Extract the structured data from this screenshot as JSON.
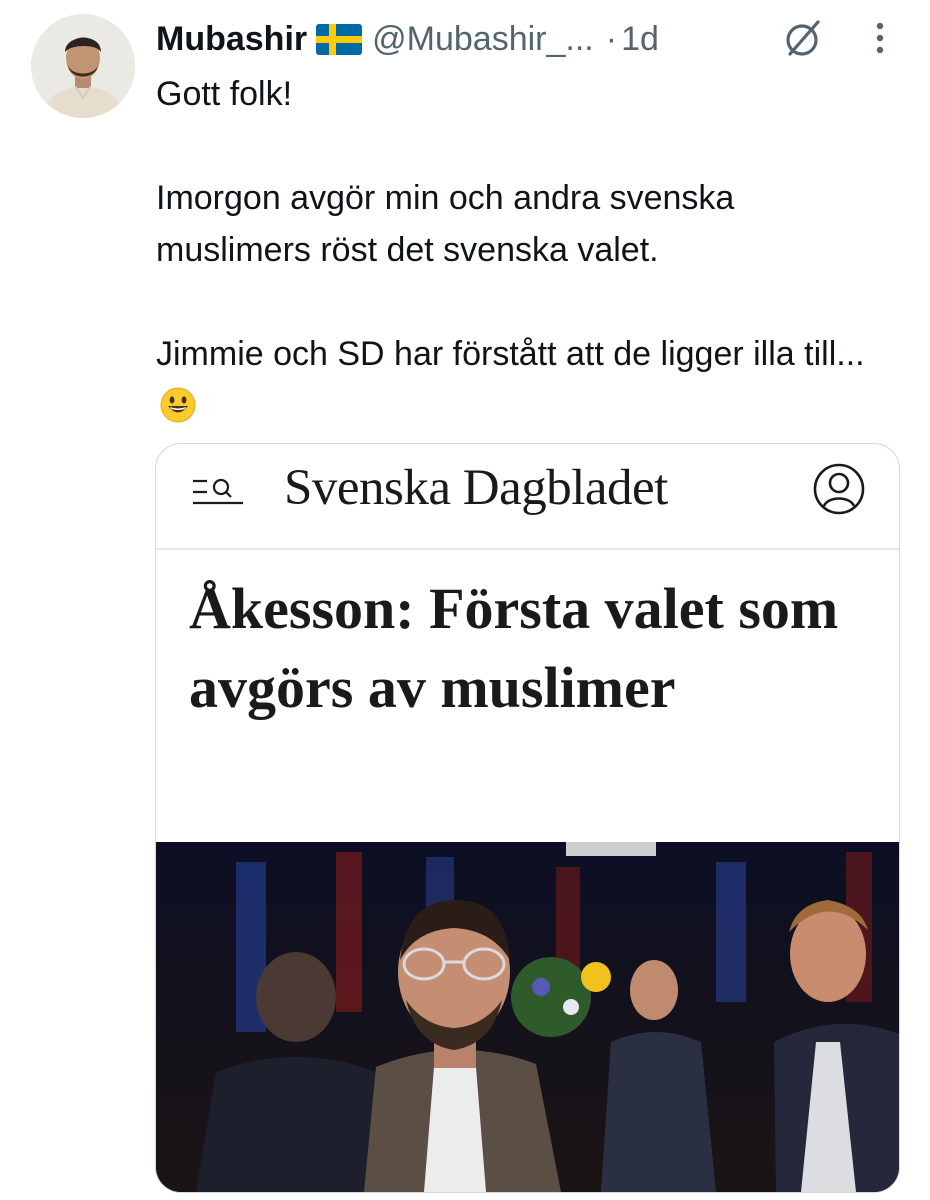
{
  "tweet": {
    "author_name": "Mubashir",
    "author_flag": "swedish-flag",
    "handle": "@Mubashir_...",
    "separator": "·",
    "time": "1d",
    "text": {
      "line1": "Gott folk!",
      "line2": "Imorgon avgör min och andra svenska muslimers röst det svenska valet.",
      "line3": "Jimmie och SD har förstått att de ligger illa till...",
      "emoji": "grinning-face-emoji"
    }
  },
  "card": {
    "brand": "Svenska Dagbladet",
    "headline": "Åkesson: Första valet som avgörs av muslimer",
    "icons": [
      "menu-search-icon",
      "account-icon"
    ]
  },
  "colors": {
    "text_primary": "#0f1419",
    "text_secondary": "#536471",
    "border": "#cfd9de",
    "flag_blue": "#006aa7",
    "flag_yellow": "#fecc00"
  }
}
